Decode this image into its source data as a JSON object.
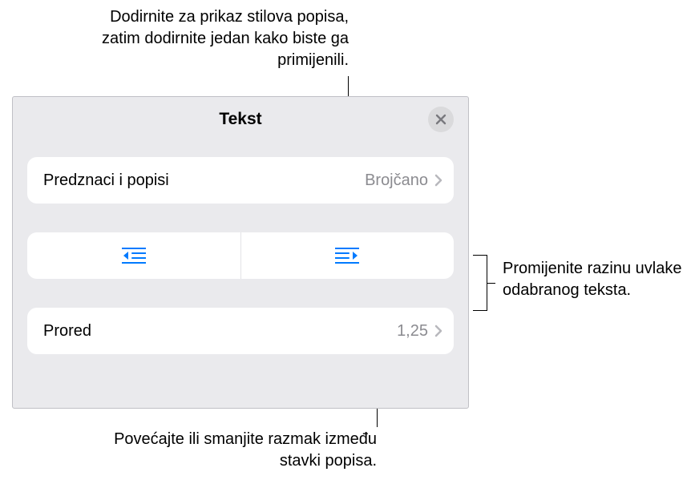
{
  "callouts": {
    "top": "Dodirnite za prikaz stilova popisa, zatim dodirnite jedan kako biste ga primijenili.",
    "right": "Promijenite razinu uvlake odabranog teksta.",
    "bottom": "Povećajte ili smanjite razmak između stavki popisa."
  },
  "panel": {
    "title": "Tekst",
    "bullets_row": {
      "label": "Predznaci i popisi",
      "value": "Brojčano"
    },
    "indent": {
      "outdent_name": "outdent",
      "indent_name": "indent"
    },
    "spacing_row": {
      "label": "Prored",
      "value": "1,25"
    }
  }
}
